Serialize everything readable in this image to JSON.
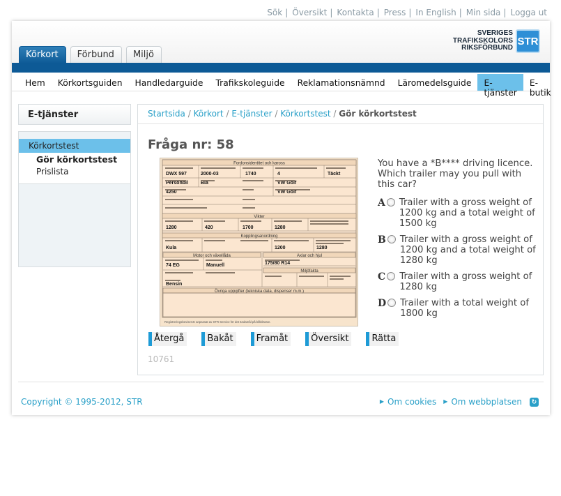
{
  "top_links": [
    "Sök",
    "Översikt",
    "Kontakta",
    "Press",
    "In English",
    "Min sida",
    "Logga ut"
  ],
  "tabs": [
    "Körkort",
    "Förbund",
    "Miljö"
  ],
  "logo": {
    "lines": [
      "SVERIGES",
      "TRAFIKSKOLORS",
      "RIKSFÖRBUND"
    ],
    "badge": "STR"
  },
  "nav": [
    "Hem",
    "Körkortsguiden",
    "Handledarguide",
    "Trafikskoleguide",
    "Reklamationsnämnd",
    "Läromedelsguide",
    "E-tjänster",
    "E-butik"
  ],
  "sidebar": {
    "title": "E-tjänster",
    "item": "Körkortstest",
    "sub1": "Gör körkortstest",
    "sub2": "Prislista"
  },
  "breadcrumb": {
    "items": [
      "Startsida",
      "Körkort",
      "E-tjänster",
      "Körkortstest"
    ],
    "current": "Gör körkortstest",
    "sep": "/"
  },
  "question": {
    "title": "Fråga nr: 58",
    "text": "You have a *B**** driving licence. Which trailer may you pull with this car?",
    "answers": [
      {
        "letter": "A",
        "text": "Trailer with a gross weight of 1200 kg and a total weight of 1500 kg"
      },
      {
        "letter": "B",
        "text": "Trailer with a gross weight of 1200 kg and a total weight of 1280 kg"
      },
      {
        "letter": "C",
        "text": "Trailer with a gross weight of 1280 kg"
      },
      {
        "letter": "D",
        "text": "Trailer with a total weight of 1800 kg"
      }
    ]
  },
  "registration": {
    "h1": "Fordonsidentitet och kaross",
    "reg": "DWX 597",
    "date": "2000-03",
    "width": "1740",
    "seats": "4",
    "body": "Täckt",
    "type": "Personbil",
    "color": "Blå",
    "make": "VW Golf",
    "length": "4250",
    "model": "VW Golf",
    "h2": "Vikter",
    "w1": "1280",
    "w2": "420",
    "w3": "1700",
    "w4": "1280",
    "h3": "Kopplingsanordning",
    "coupling": "Kula",
    "c1": "1200",
    "c2": "1280",
    "h4": "Motor och växellåda",
    "h5": "Axlar och hjul",
    "engine": "74 EG",
    "gear": "Manuell",
    "tyres": "175/80 R14",
    "h6": "Miljöfakta",
    "fuel": "Bensin",
    "h7": "Övriga uppgifter (tekniska data, dispenser m.m.)",
    "foot": "Registreringsbeviset är anpassat av STR Service för det ändamål på blikklärare."
  },
  "buttons": [
    "Återgå",
    "Bakåt",
    "Framåt",
    "Översikt",
    "Rätta"
  ],
  "question_id": "10761",
  "footer": {
    "copyright": "Copyright © 1995-2012, STR",
    "links": [
      "Om cookies",
      "Om webbplatsen"
    ]
  },
  "colors": {
    "brand_blue": "#0d5a96",
    "accent_cyan": "#6cc0ea",
    "link": "#2aa0c8"
  }
}
